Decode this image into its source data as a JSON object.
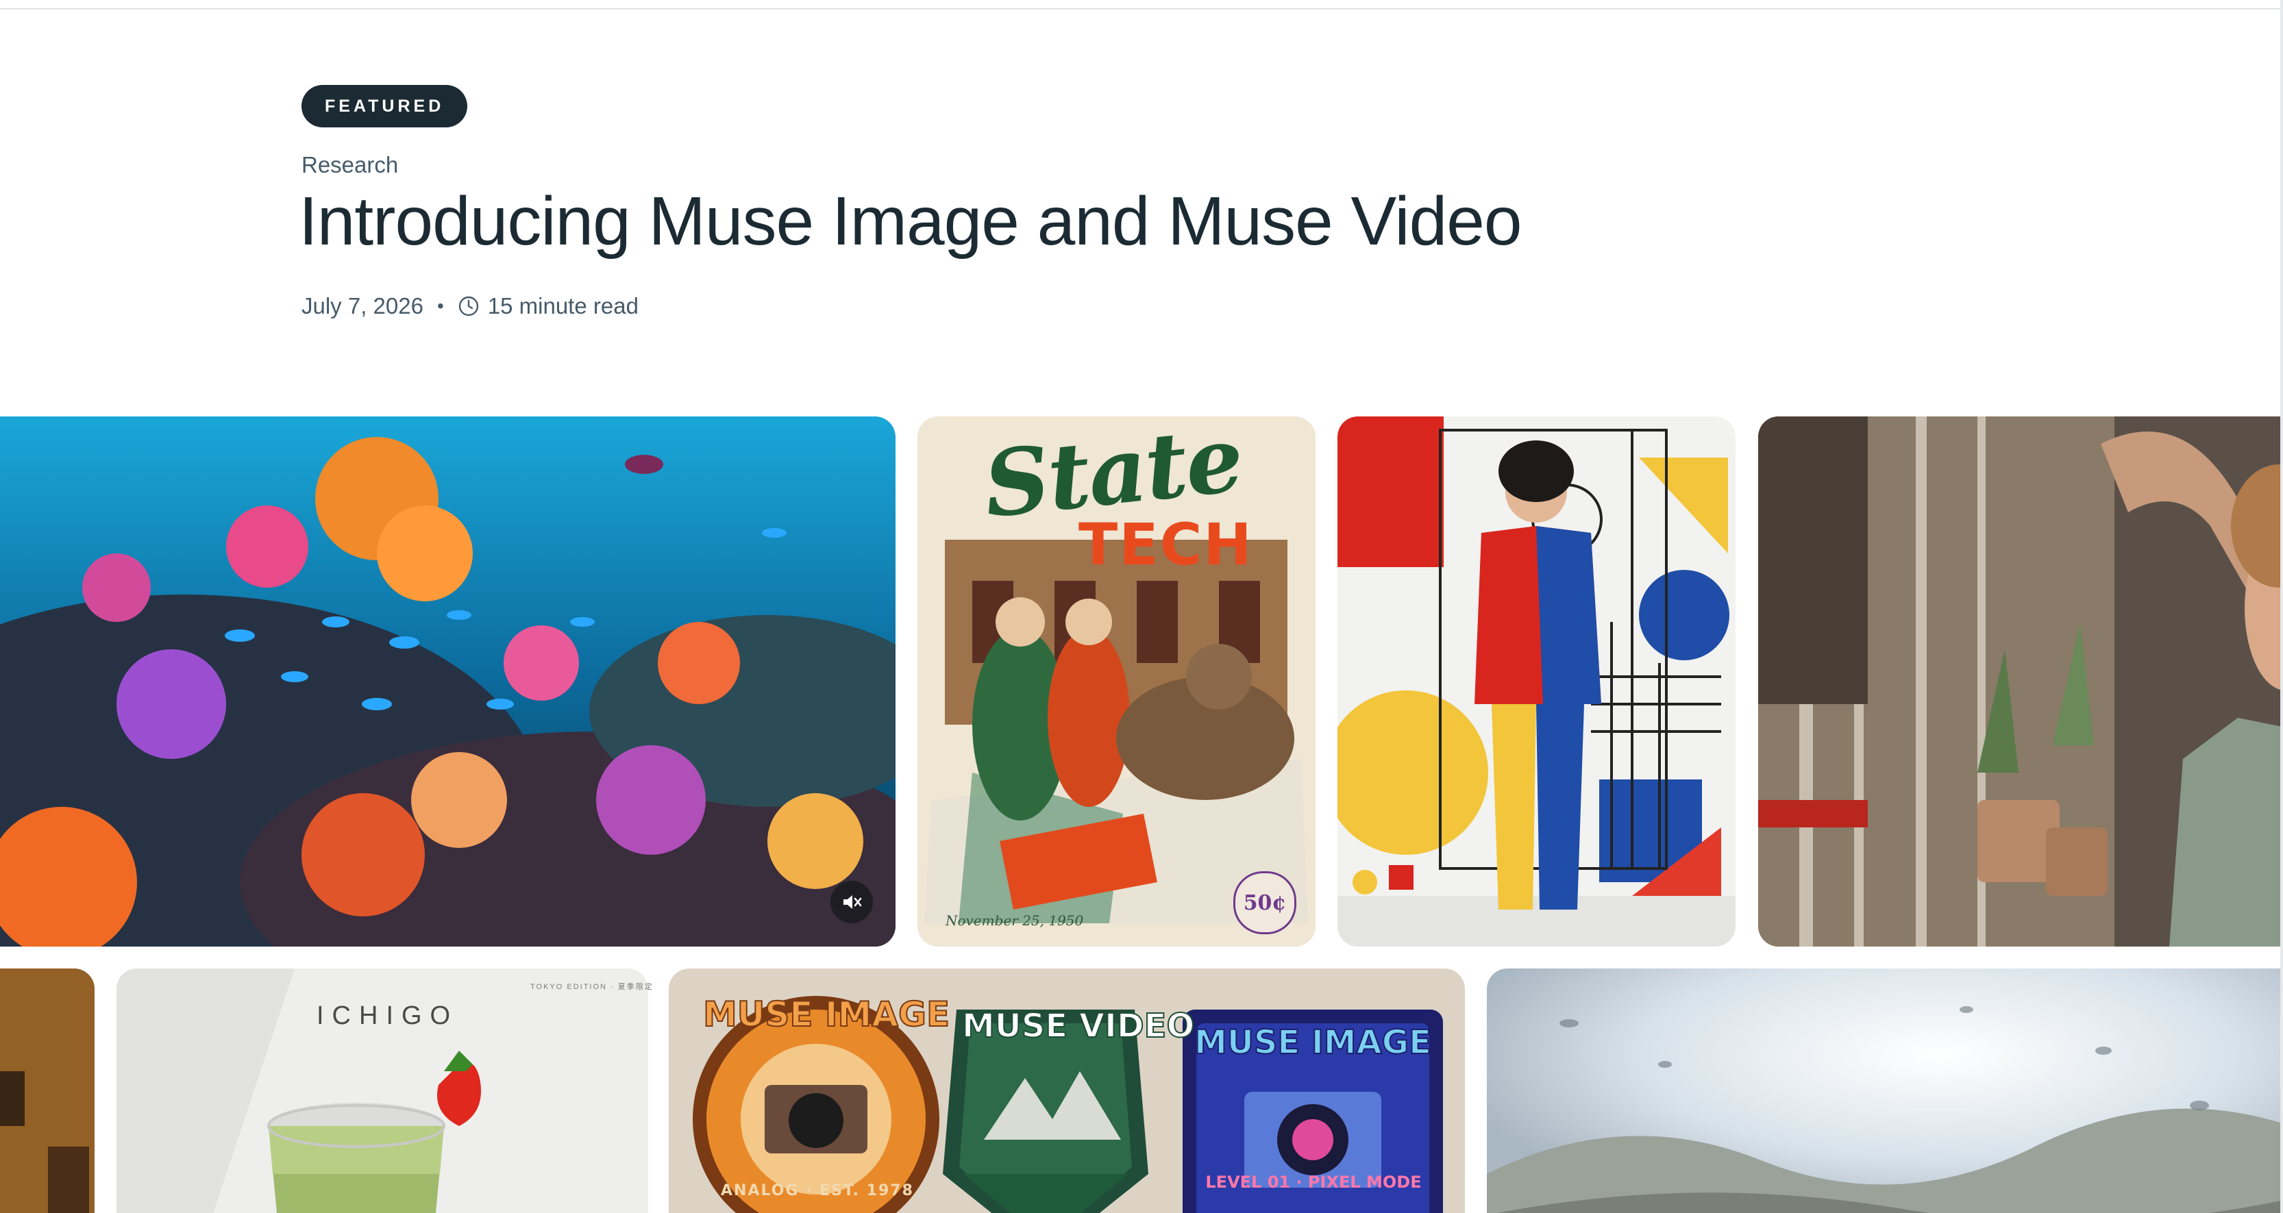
{
  "article": {
    "badge": "FEATURED",
    "category": "Research",
    "title": "Introducing Muse Image and Muse Video",
    "date": "July 7, 2026",
    "separator": "•",
    "read_time": "15 minute read"
  },
  "gallery": {
    "mute_icon": "speaker-muted-icon",
    "state_tech": {
      "script": "State",
      "bold": "TECH",
      "date": "November 25, 1950",
      "price": "50¢"
    },
    "ichigo": {
      "brand": "ICHIGO",
      "edition": "TOKYO EDITION · 夏季限定"
    },
    "patches": {
      "left_title": "MUSE IMAGE",
      "left_sub": "ANALOG · EST. 1978",
      "middle_title": "MUSE VIDEO",
      "right_title": "MUSE IMAGE",
      "right_sub": "LEVEL 01 · PIXEL MODE"
    }
  },
  "colors": {
    "text_primary": "#1c2b33",
    "text_secondary": "#465a69",
    "badge_bg": "#1c2b33",
    "badge_text": "#ffffff"
  }
}
